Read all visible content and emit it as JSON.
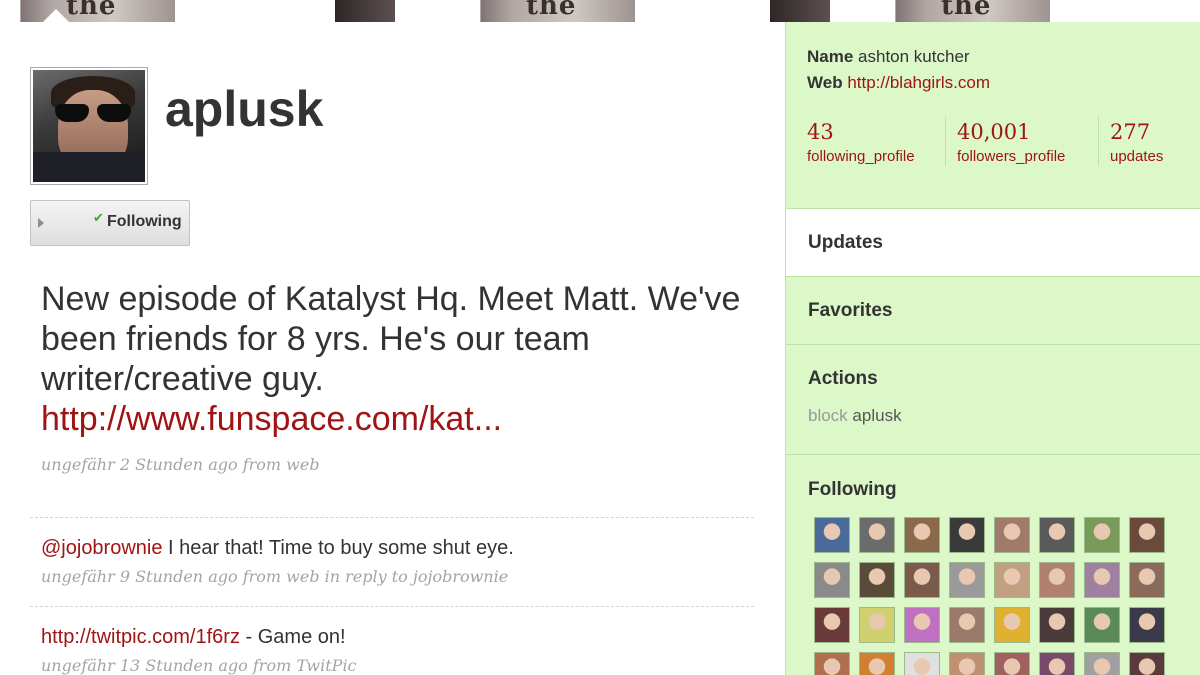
{
  "banner": {
    "text": "the gggp"
  },
  "profile": {
    "username": "aplusk",
    "follow_button_label": "Following"
  },
  "tweets": [
    {
      "text": "New episode of Katalyst Hq. Meet Matt. We've been friends for 8 yrs. He's our team writer/creative guy.",
      "link": "http://www.funspace.com/kat...",
      "meta": "ungefähr 2 Stunden ago from web"
    },
    {
      "mention": "@jojobrownie",
      "text": " I hear that! Time to buy some shut eye.",
      "meta": "ungefähr 9 Stunden ago from web in reply to jojobrownie"
    },
    {
      "link": "http://twitpic.com/1f6rz",
      "text": " - Game on!",
      "meta": "ungefähr 13 Stunden ago from TwitPic"
    }
  ],
  "sidebar": {
    "name_label": "Name",
    "name_value": "ashton kutcher",
    "web_label": "Web",
    "web_value": "http://blahgirls.com",
    "stats": [
      {
        "count": "43",
        "label": "following_profile"
      },
      {
        "count": "40,001",
        "label": "followers_profile"
      },
      {
        "count": "277",
        "label": "updates"
      }
    ],
    "updates_label": "Updates",
    "favorites_label": "Favorites",
    "actions_label": "Actions",
    "block_label": "block",
    "block_name": "aplusk",
    "following_label": "Following"
  },
  "following_avatars": [
    "#4a6a9a",
    "#6b6b6b",
    "#8a6a4a",
    "#3a3a3a",
    "#a07a6a",
    "#5a5a5a",
    "#7a9a5a",
    "#6a4a3a",
    "#8a8a8a",
    "#5a4a3a",
    "#7a5a4a",
    "#9a9a9a",
    "#c0a080",
    "#b08070",
    "#a080a0",
    "#8a6a5a",
    "#6a3a3a",
    "#d0d070",
    "#c070c0",
    "#9a7a6a",
    "#e0b030",
    "#4a3a3a",
    "#5a8a5a",
    "#3a3a4a",
    "#b07050",
    "#d08030",
    "#e0e0e0",
    "#c09070",
    "#a06060",
    "#7a4a6a",
    "#a0a0a0",
    "#5a3a3a"
  ]
}
